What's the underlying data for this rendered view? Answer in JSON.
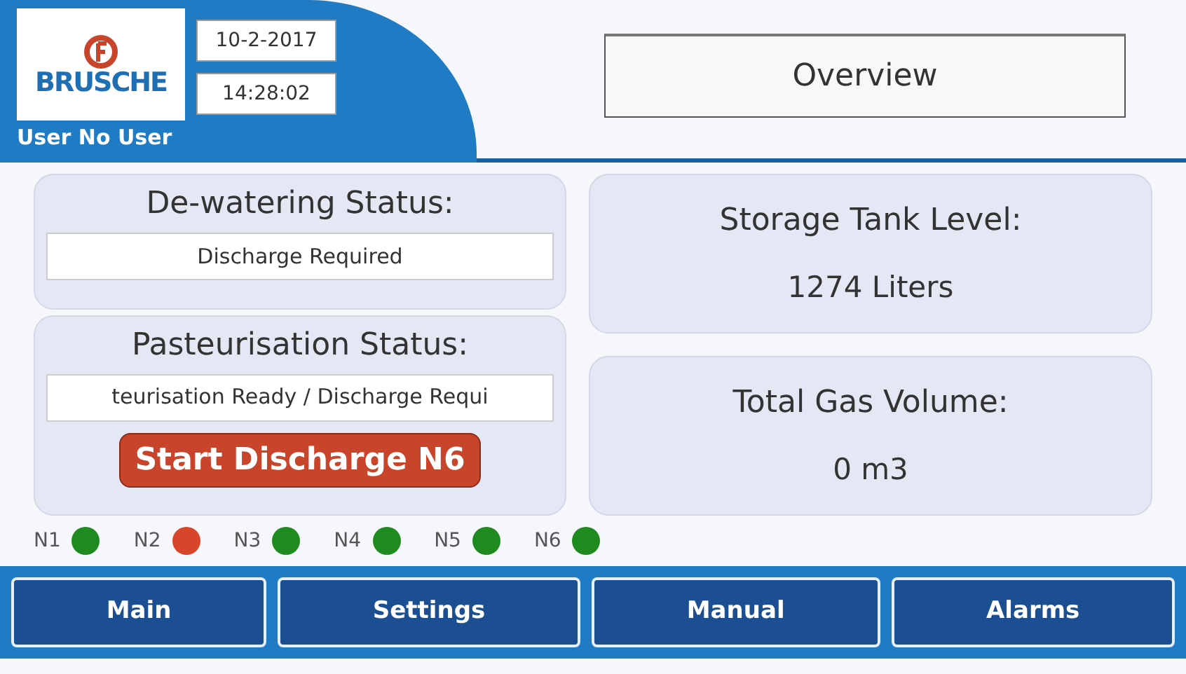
{
  "header": {
    "brand": "BRUSCHE",
    "date": "10-2-2017",
    "time": "14:28:02",
    "user": "User No User",
    "screen_title": "Overview"
  },
  "left_panels": [
    {
      "title": "De-watering Status:",
      "value": "Discharge Required"
    },
    {
      "title": "Pasteurisation Status:",
      "value": "teurisation Ready / Discharge Requi",
      "button": "Start Discharge N6"
    }
  ],
  "right_panels": [
    {
      "title": "Storage Tank Level:",
      "value": "1274 Liters"
    },
    {
      "title": "Total Gas Volume:",
      "value": "0 m3"
    }
  ],
  "nodes": [
    {
      "label": "N1",
      "color": "#1f8a1f"
    },
    {
      "label": "N2",
      "color": "#d9452a"
    },
    {
      "label": "N3",
      "color": "#1f8a1f"
    },
    {
      "label": "N4",
      "color": "#1f8a1f"
    },
    {
      "label": "N5",
      "color": "#1f8a1f"
    },
    {
      "label": "N6",
      "color": "#1f8a1f"
    }
  ],
  "nav_buttons": [
    "Main",
    "Settings",
    "Manual",
    "Alarms"
  ]
}
